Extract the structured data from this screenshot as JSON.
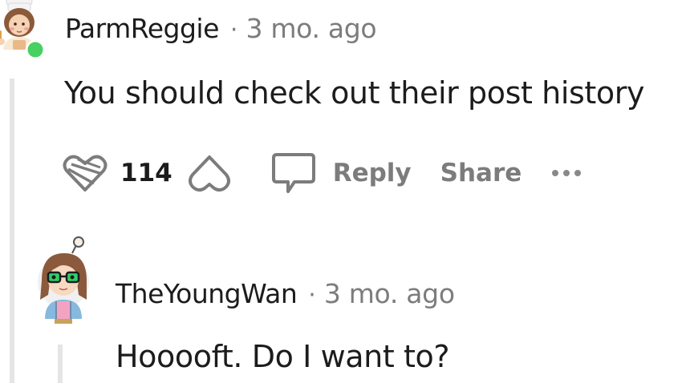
{
  "comments": [
    {
      "username": "ParmReggie",
      "separator": "·",
      "timestamp": "3 mo. ago",
      "body": "You should check out their post history",
      "vote_count": "114",
      "reply_label": "Reply",
      "share_label": "Share",
      "online": true
    },
    {
      "username": "TheYoungWan",
      "separator": "·",
      "timestamp": "3 mo. ago",
      "body": "Hooooft. Do I want to?"
    }
  ],
  "colors": {
    "online_dot": "#46d160",
    "meta_text": "#7c7c7c",
    "thread_line": "#e5e5e5",
    "primary_text": "#1c1c1c"
  },
  "icons": [
    "upvote-icon",
    "downvote-icon",
    "comment-bubble-icon",
    "more-dots-icon",
    "online-status-icon"
  ]
}
